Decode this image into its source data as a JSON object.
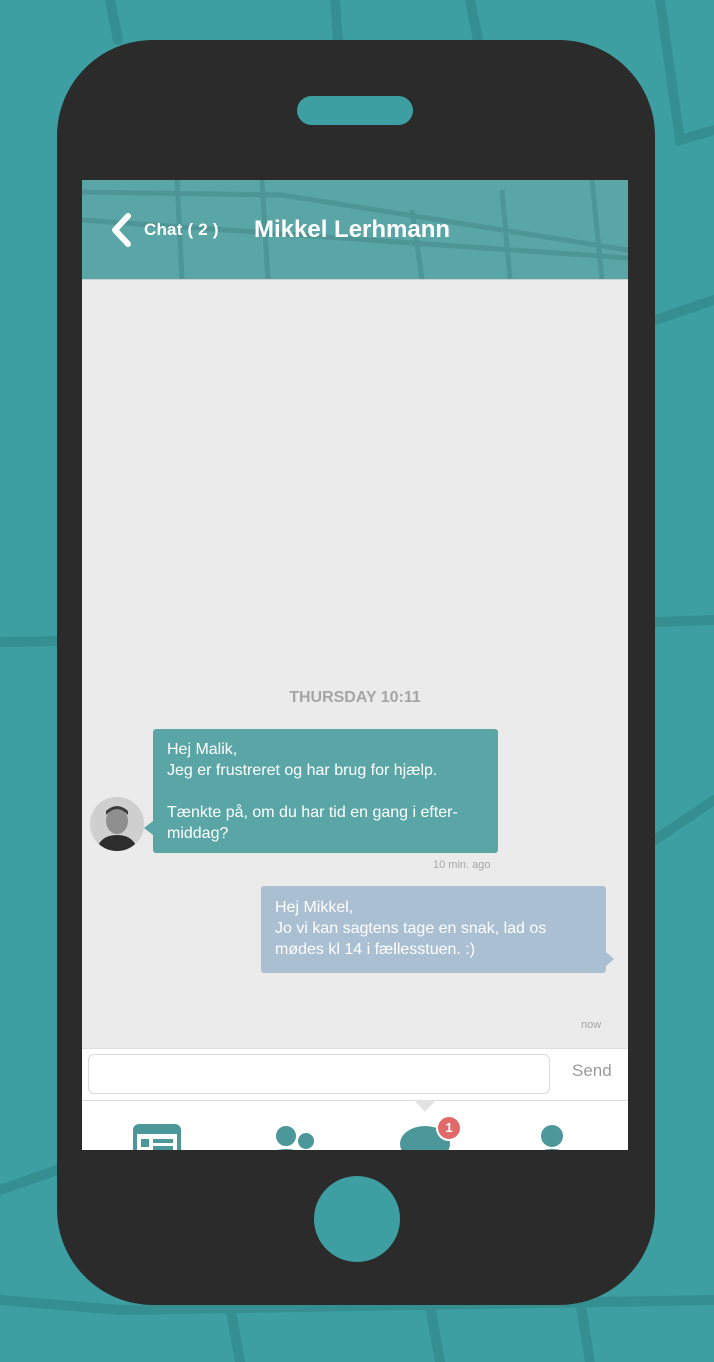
{
  "colors": {
    "background": "#3d9fa1",
    "phone_body": "#2b2b2b",
    "header": "#5aa6a7",
    "incoming_bubble": "#5aa6a7",
    "outgoing_bubble": "#aabfd2",
    "badge": "#e06a6a",
    "tab_icon": "#4c9799"
  },
  "header": {
    "back_label": "Chat ( 2 )",
    "title": "Mikkel Lerhmann"
  },
  "conversation": {
    "day_stamp": "THURSDAY 10:11",
    "messages": [
      {
        "direction": "incoming",
        "lines": [
          "Hej Malik,",
          "Jeg er frustreret og har brug for hjælp.",
          "",
          "Tænkte på, om du har tid en gang i efter-",
          "middag?"
        ],
        "time": "10 min. ago"
      },
      {
        "direction": "outgoing",
        "lines": [
          "Hej Mikkel,",
          "Jo vi kan sagtens tage en snak, lad os",
          "mødes kl 14 i fællesstuen. :)"
        ],
        "time": "now"
      }
    ]
  },
  "composer": {
    "placeholder": "",
    "send_label": "Send"
  },
  "tabbar": {
    "tabs": [
      {
        "icon": "news-feed-icon",
        "active": false
      },
      {
        "icon": "group-icon",
        "active": false
      },
      {
        "icon": "chat-bubble-icon",
        "active": true,
        "badge": "1"
      },
      {
        "icon": "profile-icon",
        "active": false
      }
    ]
  }
}
